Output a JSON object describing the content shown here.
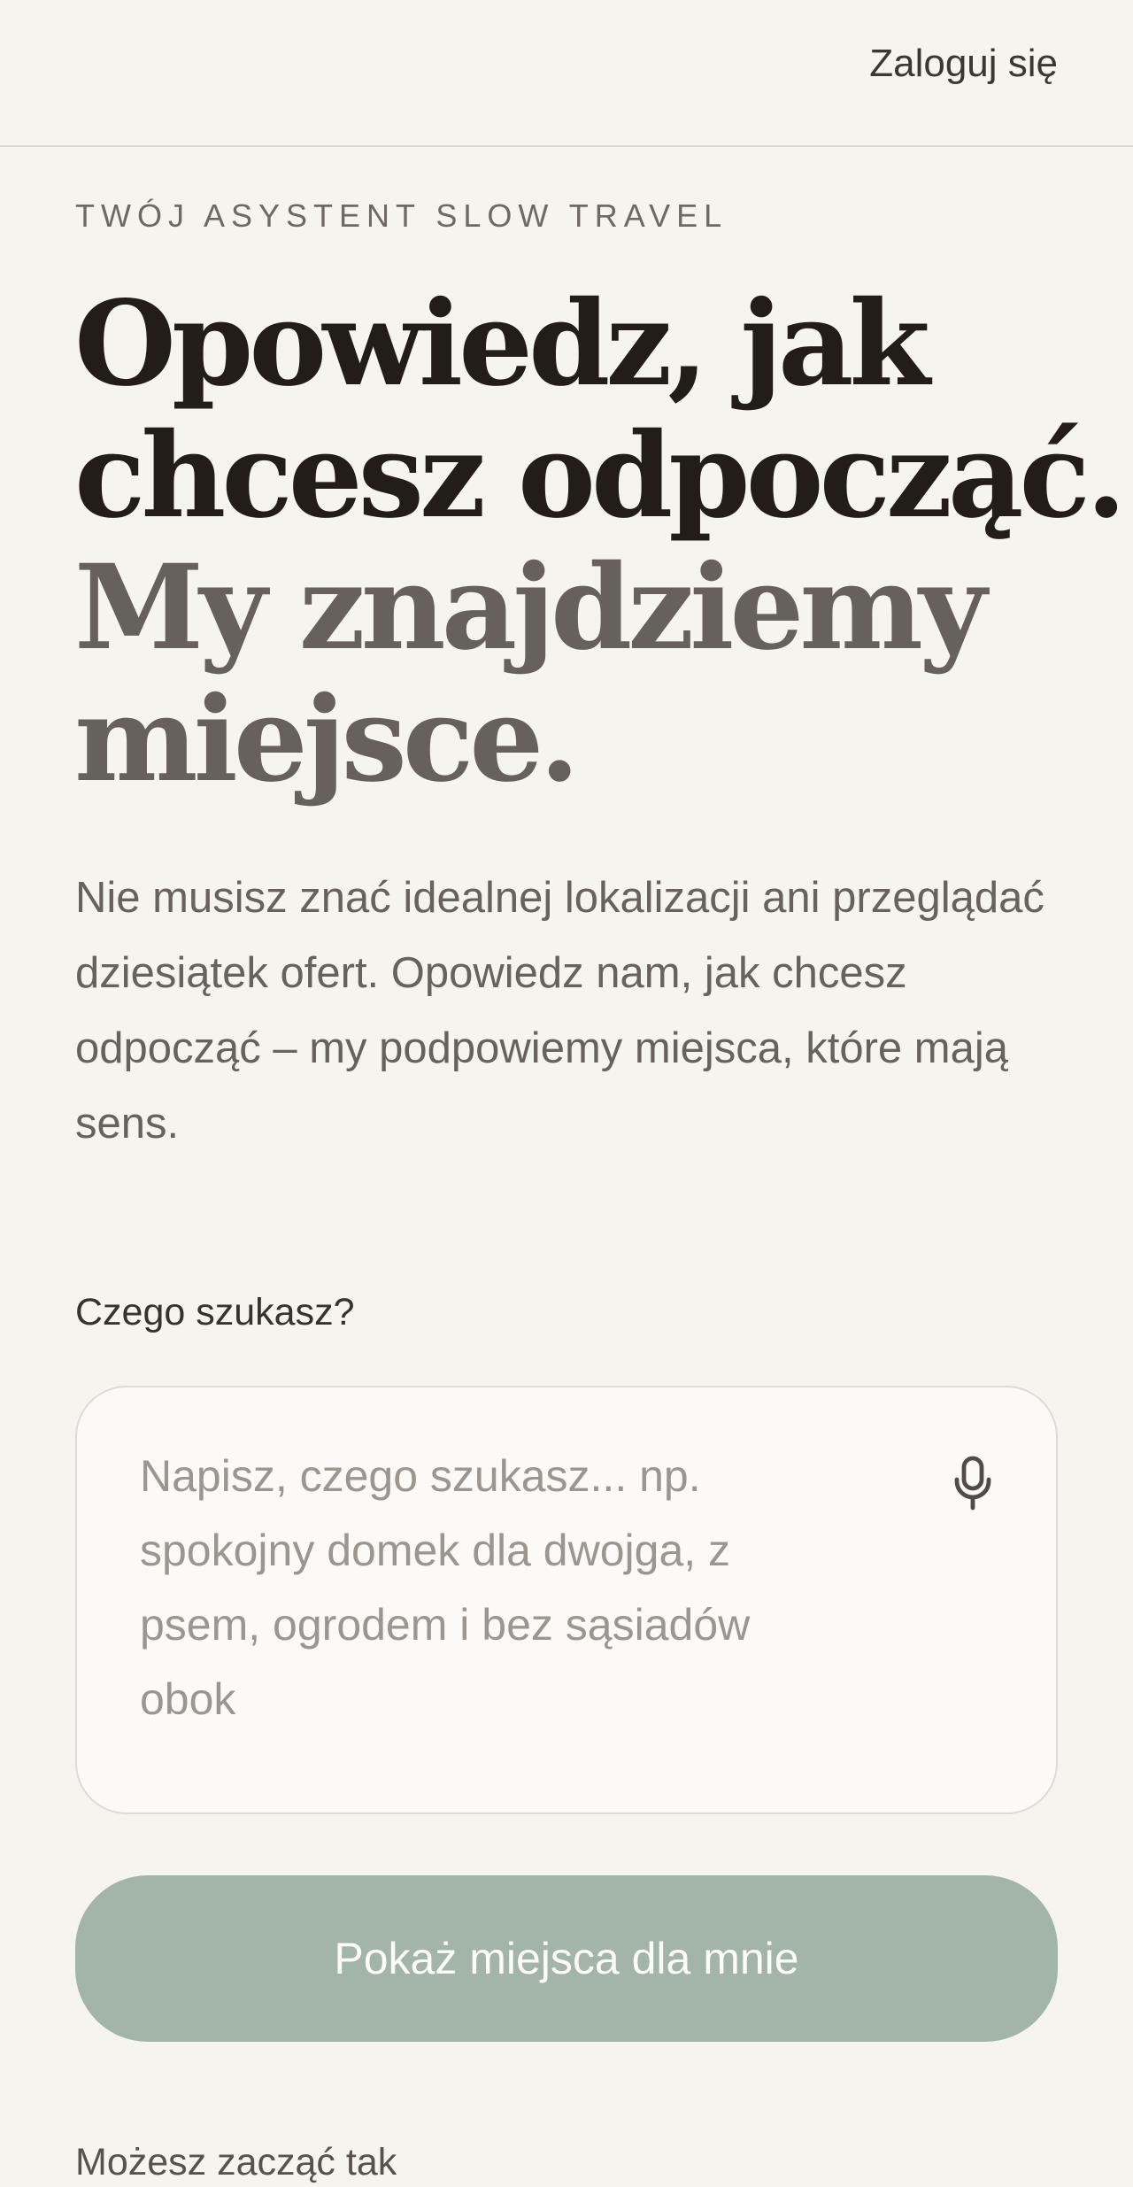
{
  "header": {
    "login_label": "Zaloguj się"
  },
  "hero": {
    "eyebrow": "TWÓJ ASYSTENT SLOW TRAVEL",
    "headline_line_1": "Opowiedz, jak",
    "headline_line_2": "chcesz odpocząć.",
    "headline_line_3": "My znajdziemy",
    "headline_line_4": "miejsce.",
    "description": "Nie musisz znać idealnej lokalizacji ani przeglądać dziesiątek ofert. Opowiedz nam, jak chcesz odpocząć – my podpowiemy miejsca, które mają sens."
  },
  "search": {
    "label": "Czego szukasz?",
    "value": "",
    "placeholder": "Napisz, czego szukasz... np. spokojny domek dla dwojga, z psem, ogrodem i bez sąsiadów obok",
    "mic_icon": "microphone-icon"
  },
  "actions": {
    "submit_label": "Pokaż miejsca dla mnie"
  },
  "suggestions": {
    "label": "Możesz zacząć tak"
  },
  "colors": {
    "background": "#f6f4ef",
    "text": "#26211d",
    "muted_text": "#68625c",
    "button": "#a3b5a9",
    "input_background": "#fbfaf7"
  }
}
